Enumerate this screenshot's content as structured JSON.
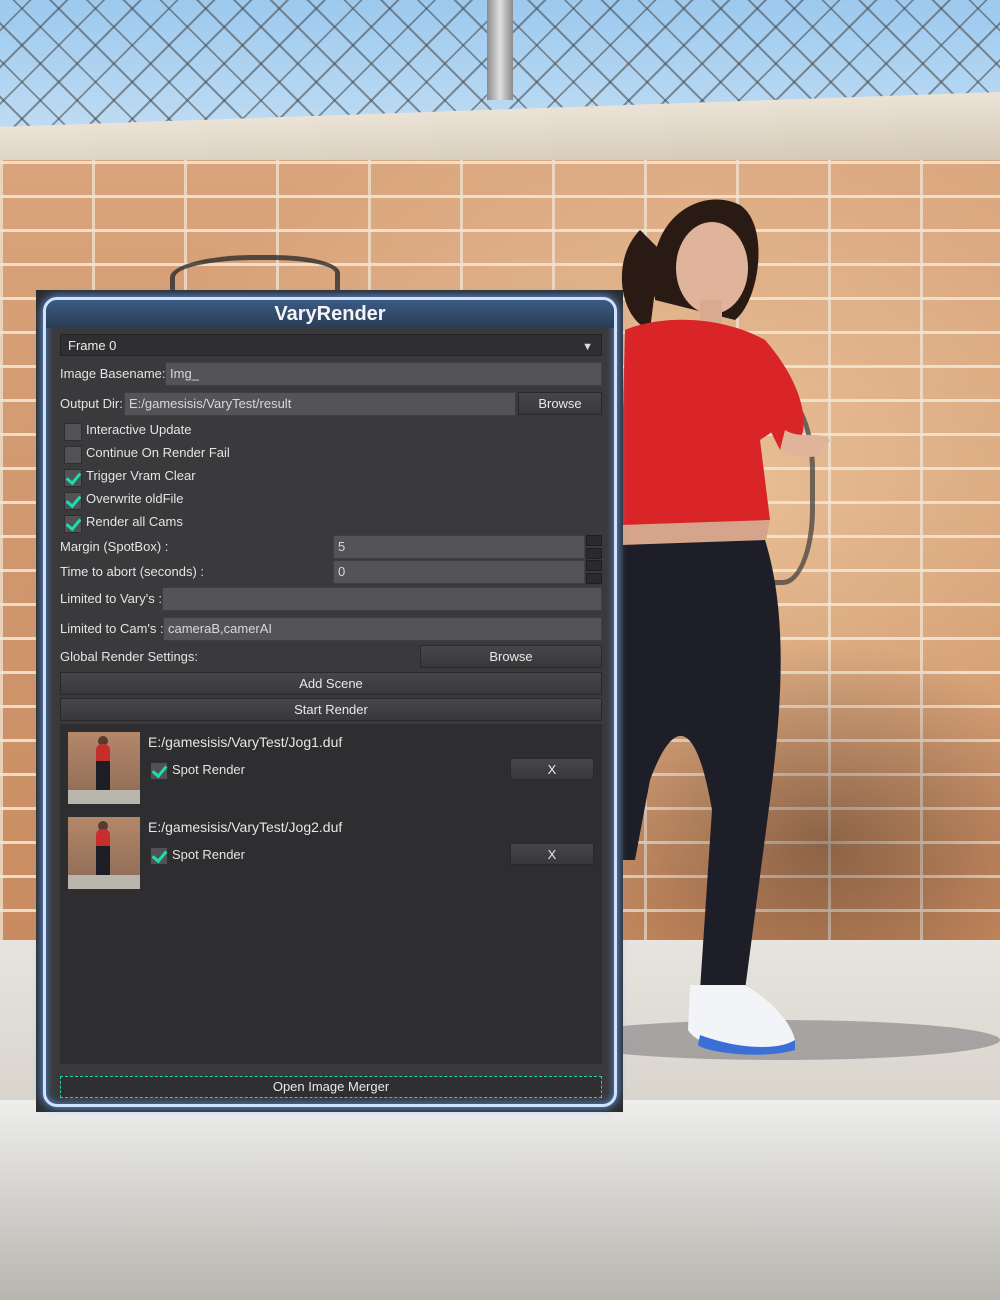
{
  "dialog": {
    "title": "VaryRender",
    "frame_select": "Frame 0",
    "image_basename": {
      "label": "Image Basename:",
      "value": "Img_"
    },
    "output_dir": {
      "label": "Output Dir:",
      "value": "E:/gamesisis/VaryTest/result",
      "browse_label": "Browse"
    },
    "options": [
      {
        "label": "Interactive Update",
        "checked": false
      },
      {
        "label": "Continue On Render Fail",
        "checked": false
      },
      {
        "label": "Trigger Vram Clear",
        "checked": true
      },
      {
        "label": "Overwrite oldFile",
        "checked": true
      },
      {
        "label": "Render all Cams",
        "checked": true
      }
    ],
    "margin": {
      "label": "Margin (SpotBox) :",
      "value": "5"
    },
    "abort_time": {
      "label": "Time to abort (seconds) :",
      "value": "0"
    },
    "limited_varys": {
      "label": "Limited to Vary's :",
      "value": ""
    },
    "limited_cams": {
      "label": "Limited to Cam's :",
      "value": "cameraB,camerAI"
    },
    "global_render": {
      "label": "Global Render Settings:",
      "browse_label": "Browse"
    },
    "add_scene_label": "Add Scene",
    "start_render_label": "Start Render",
    "scenes": [
      {
        "path": "E:/gamesisis/VaryTest/Jog1.duf",
        "spot_label": "Spot Render",
        "spot_checked": true,
        "remove_label": "X"
      },
      {
        "path": "E:/gamesisis/VaryTest/Jog2.duf",
        "spot_label": "Spot Render",
        "spot_checked": true,
        "remove_label": "X"
      }
    ],
    "merger_label": "Open Image Merger"
  },
  "colors": {
    "title_bar": "#2f4668",
    "check_accent": "#17e0b0",
    "dialog_glow": "#6aa8ff"
  }
}
